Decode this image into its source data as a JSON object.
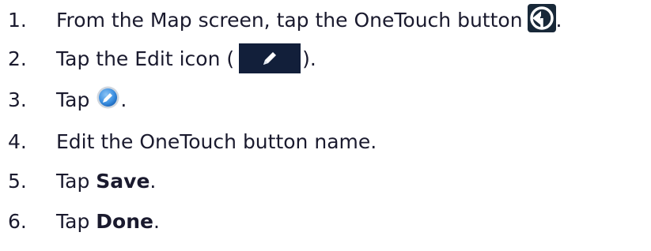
{
  "steps": [
    {
      "number": "1.",
      "text": "From the Map screen, tap the OneTouch button",
      "icon": "onetouch-icon",
      "after": "."
    },
    {
      "number": "2.",
      "before": "Tap the Edit icon (",
      "icon": "edit-pencil-icon",
      "after": ")."
    },
    {
      "number": "3.",
      "before": "Tap",
      "icon": "circle-edit-icon",
      "after": "."
    },
    {
      "number": "4.",
      "text": "Edit the OneTouch button name."
    },
    {
      "number": "5.",
      "before": "Tap ",
      "bold": "Save",
      "after": "."
    },
    {
      "number": "6.",
      "before": "Tap ",
      "bold": "Done",
      "after": "."
    }
  ],
  "colors": {
    "text": "#1a1a2e",
    "icon_dark_bg": "#182838",
    "edit_box_bg": "#121f3a",
    "circle_blue": "#3c8fe0"
  }
}
